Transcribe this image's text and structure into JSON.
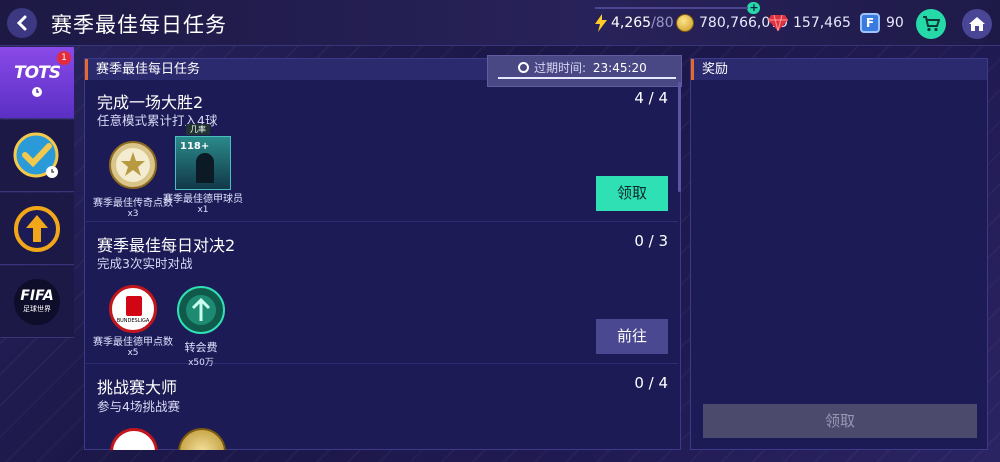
{
  "header": {
    "title": "赛季最佳每日任务",
    "energy_value": "4,265",
    "energy_max": "/80",
    "coins": "780,766,079",
    "gems": "157,465",
    "fifa_points": "90",
    "fifa_points_icon_letter": "F"
  },
  "sidebar": {
    "tabs": [
      {
        "name": "tots",
        "label": "TOTS",
        "badge": "1"
      },
      {
        "name": "daily-check",
        "label": ""
      },
      {
        "name": "upgrade",
        "label": ""
      },
      {
        "name": "fifa-world",
        "label": "FIFA",
        "sublabel": "足球世界"
      }
    ]
  },
  "tasks_panel": {
    "title": "赛季最佳每日任务",
    "expiry_label": "过期时间:",
    "expiry_time": "23:45:20"
  },
  "tasks": [
    {
      "title": "完成一场大胜2",
      "subtitle": "任意模式累计打入4球",
      "progress": "4 / 4",
      "button": "领取",
      "rewards": [
        {
          "name": "赛季最佳传奇点数",
          "qty": "x3"
        },
        {
          "name": "赛季最佳德甲球员",
          "qty": "x1",
          "tag": "几率",
          "rating": "118+"
        }
      ]
    },
    {
      "title": "赛季最佳每日对决2",
      "subtitle": "完成3次实时对战",
      "progress": "0 / 3",
      "button": "前往",
      "rewards": [
        {
          "name": "赛季最佳德甲点数",
          "qty": "x5",
          "logo_text": "BUNDESLIGA"
        },
        {
          "name": "转会费",
          "qty": "x50万"
        }
      ]
    },
    {
      "title": "挑战赛大师",
      "subtitle": "参与4场挑战赛",
      "progress": "0 / 4"
    }
  ],
  "reward_panel": {
    "title": "奖励",
    "claim_button": "领取"
  },
  "colors": {
    "accent_green": "#2fe0b4",
    "panel_bg": "#1c1b55",
    "header_accent": "#e86a2a"
  }
}
